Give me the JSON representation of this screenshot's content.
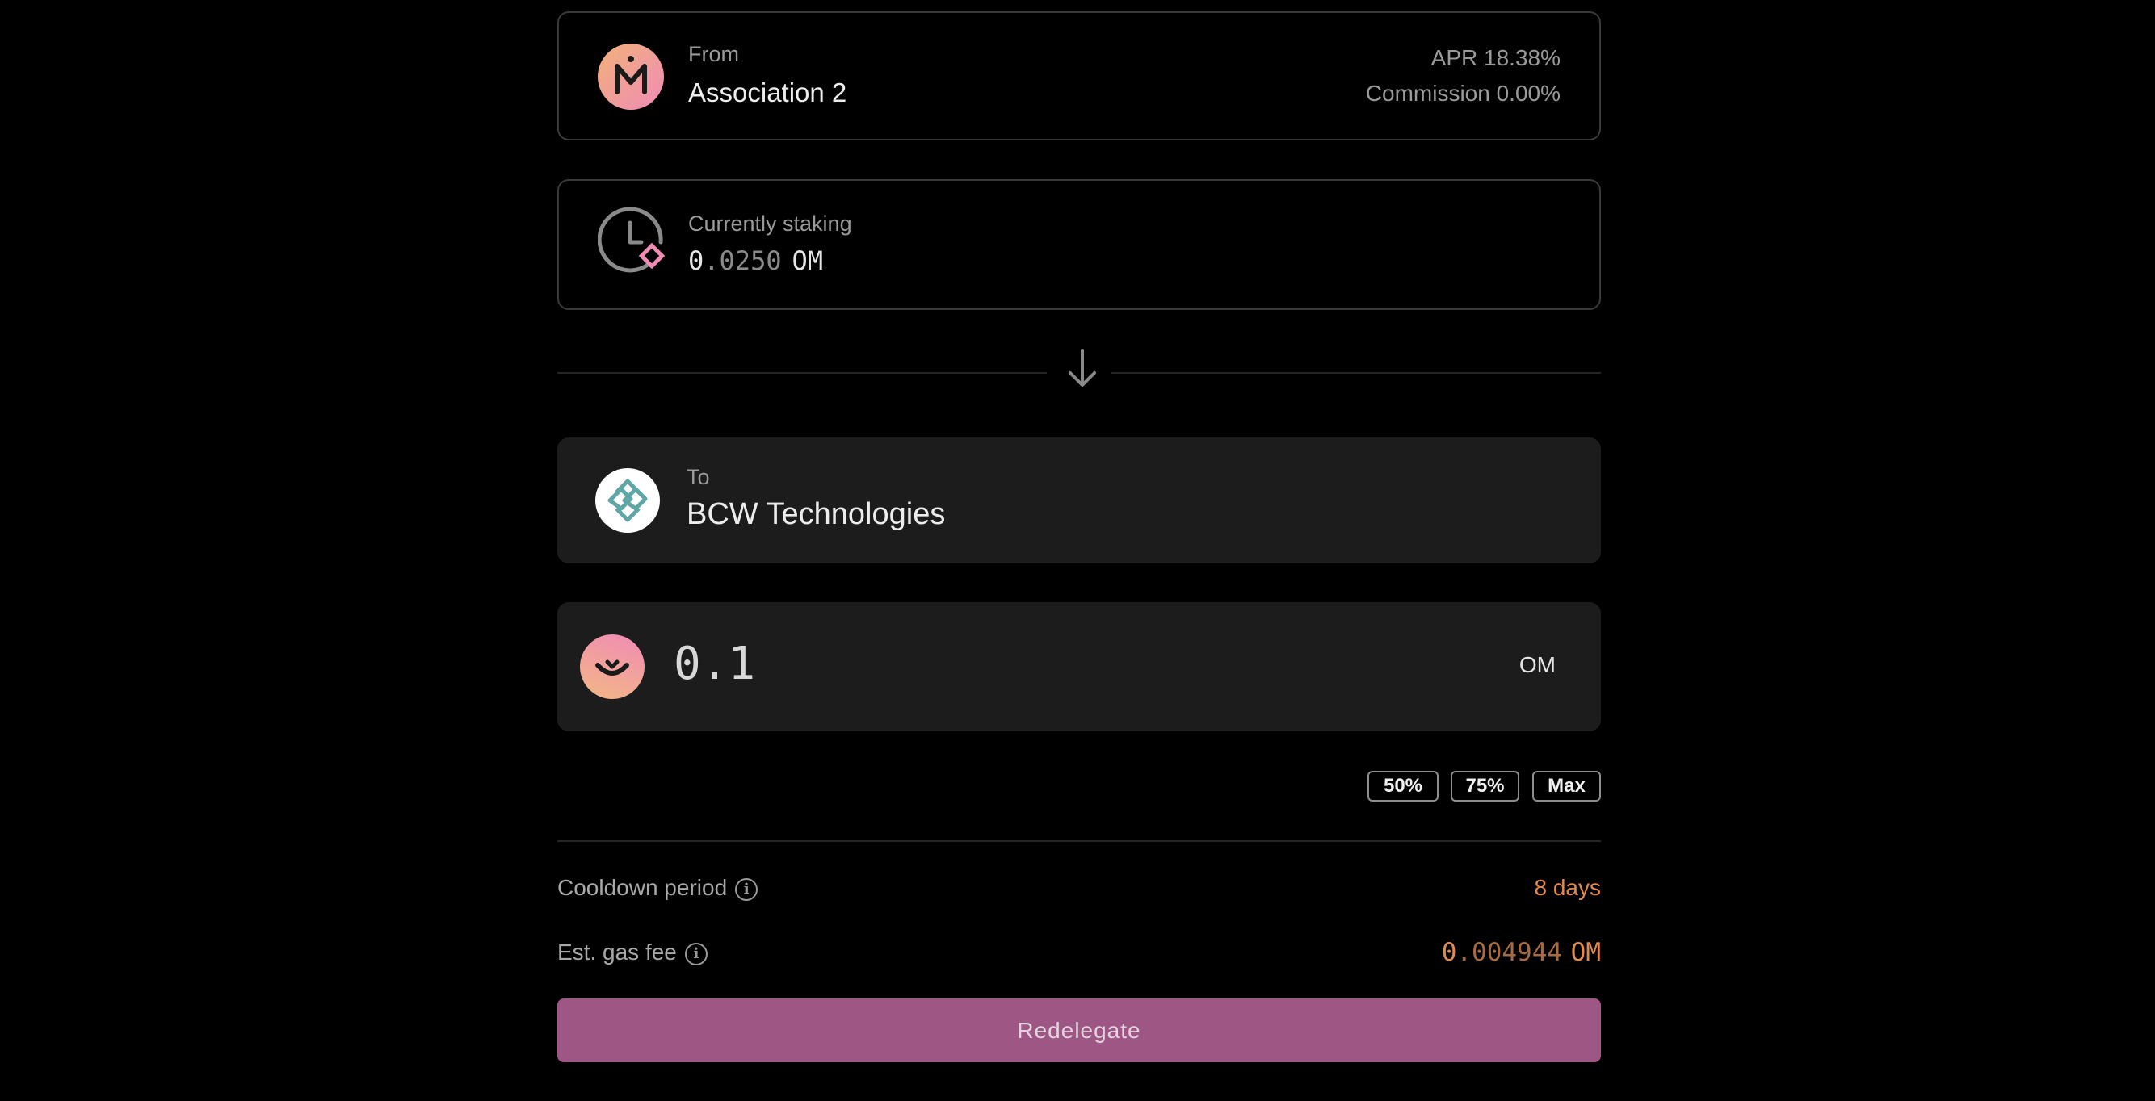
{
  "from": {
    "label": "From",
    "name": "Association 2",
    "apr": "APR 18.38%",
    "commission": "Commission 0.00%",
    "avatar_icon": "mantra-logo-icon"
  },
  "staking": {
    "label": "Currently staking",
    "amount_int": "0",
    "amount_frac": ".0250",
    "unit": "OM",
    "icon": "clock-stake-icon"
  },
  "divider": {
    "icon": "arrow-down-icon"
  },
  "to": {
    "label": "To",
    "name": "BCW Technologies",
    "avatar_icon": "bcw-logo-icon"
  },
  "amount": {
    "value": "0.1",
    "unit": "OM",
    "token_icon": "om-token-icon"
  },
  "presets": [
    "50%",
    "75%",
    "Max"
  ],
  "cooldown": {
    "label": "Cooldown period",
    "value": "8 days"
  },
  "gas": {
    "label": "Est. gas fee",
    "value_int": "0",
    "value_frac": ".004944",
    "unit": "OM"
  },
  "action": {
    "label": "Redelegate"
  },
  "colors": {
    "accent": "#9e5785",
    "warning": "#e2894d",
    "card_bg": "#1c1c1c",
    "border": "#3a3a3a"
  }
}
